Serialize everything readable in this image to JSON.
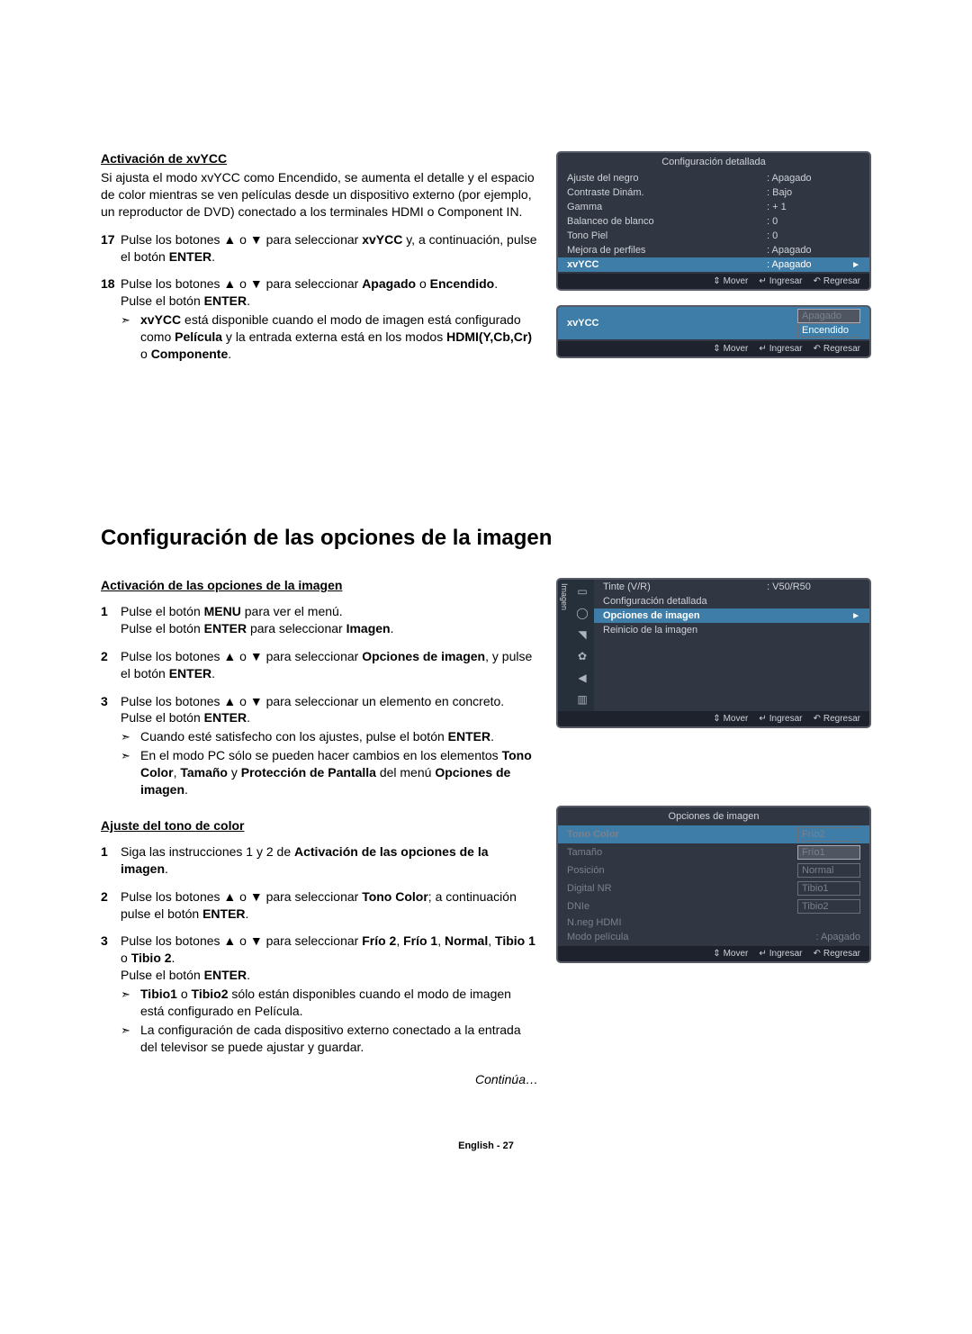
{
  "section1": {
    "title": "Activación de xvYCC",
    "intro": "Si ajusta el modo xvYCC como Encendido, se aumenta el detalle y el espacio de color mientras se ven películas desde un dispositivo externo (por ejemplo, un reproductor de DVD) conectado a los terminales HDMI o Component IN.",
    "step17_num": "17",
    "step17_a": "Pulse los botones ▲ o ▼ para seleccionar ",
    "step17_b": "xvYCC",
    "step17_c": " y, a continuación, pulse el botón ",
    "step17_d": "ENTER",
    "step17_e": ".",
    "step18_num": "18",
    "step18_a": "Pulse los botones ▲ o ▼ para seleccionar ",
    "step18_b": "Apagado",
    "step18_c": " o ",
    "step18_d": "Encendido",
    "step18_e": ".",
    "step18_f": "Pulse el botón ",
    "step18_g": "ENTER",
    "step18_h": ".",
    "note18_a": "xvYCC",
    "note18_b": " está disponible cuando el modo de imagen está configurado como ",
    "note18_c": "Película",
    "note18_d": " y la entrada externa está en los modos ",
    "note18_e": "HDMI(Y,Cb,Cr)",
    "note18_f": " o ",
    "note18_g": "Componente",
    "note18_h": "."
  },
  "heading2": "Configuración de las opciones de la imagen",
  "section2": {
    "title": "Activación de las opciones de la imagen",
    "s1_num": "1",
    "s1_a": "Pulse el botón ",
    "s1_b": "MENU",
    "s1_c": " para ver el menú.",
    "s1_d": "Pulse el botón ",
    "s1_e": "ENTER",
    "s1_f": " para seleccionar ",
    "s1_g": "Imagen",
    "s1_h": ".",
    "s2_num": "2",
    "s2_a": "Pulse los botones ▲ o ▼ para seleccionar ",
    "s2_b": "Opciones de imagen",
    "s2_c": ", y pulse el botón ",
    "s2_d": "ENTER",
    "s2_e": ".",
    "s3_num": "3",
    "s3_a": "Pulse los botones ▲ o ▼ para seleccionar un elemento en concreto.",
    "s3_b": "Pulse el botón ",
    "s3_c": "ENTER",
    "s3_d": ".",
    "n3a_a": "Cuando esté satisfecho con los ajustes, pulse el botón ",
    "n3a_b": "ENTER",
    "n3a_c": ".",
    "n3b_a": "En el modo PC sólo se pueden hacer cambios en los elementos ",
    "n3b_b": "Tono Color",
    "n3b_c": ", ",
    "n3b_d": "Tamaño",
    "n3b_e": " y ",
    "n3b_f": "Protección de Pantalla",
    "n3b_g": " del menú ",
    "n3b_h": "Opciones de imagen",
    "n3b_i": "."
  },
  "section3": {
    "title": "Ajuste del tono de color",
    "s1_num": "1",
    "s1_a": "Siga las instrucciones 1 y 2 de ",
    "s1_b": "Activación de las opciones de la imagen",
    "s1_c": ".",
    "s2_num": "2",
    "s2_a": "Pulse los botones ▲ o ▼ para seleccionar ",
    "s2_b": "Tono Color",
    "s2_c": "; a continuación pulse el botón ",
    "s2_d": "ENTER",
    "s2_e": ".",
    "s3_num": "3",
    "s3_a": "Pulse los botones ▲ o ▼ para seleccionar ",
    "s3_b": "Frío 2",
    "s3_c": ", ",
    "s3_d": "Frío 1",
    "s3_e": ", ",
    "s3_f": "Normal",
    "s3_g": ", ",
    "s3_h": "Tibio 1",
    "s3_i": " o ",
    "s3_j": "Tibio 2",
    "s3_k": ".",
    "s3_l": "Pulse el botón ",
    "s3_m": "ENTER",
    "s3_n": ".",
    "n3a_a": "Tibio1",
    "n3a_b": " o ",
    "n3a_c": "Tibio2",
    "n3a_d": " sólo están disponibles cuando el modo de imagen está configurado en Película.",
    "n3b": "La configuración de cada dispositivo externo conectado a la entrada del televisor se puede ajustar y guardar."
  },
  "continue": "Continúa…",
  "pagefoot": "English - 27",
  "osd1": {
    "title": "Configuración detallada",
    "rows": [
      {
        "label": "Ajuste del negro",
        "value": ": Apagado"
      },
      {
        "label": "Contraste Dinám.",
        "value": ": Bajo"
      },
      {
        "label": "Gamma",
        "value": ": + 1"
      },
      {
        "label": "Balanceo de blanco",
        "value": ": 0"
      },
      {
        "label": "Tono Piel",
        "value": ": 0"
      },
      {
        "label": "Mejora de perfiles",
        "value": ": Apagado"
      }
    ],
    "hl": {
      "label": "xvYCC",
      "value": ": Apagado",
      "arrow": "►"
    },
    "foot": {
      "move": "Mover",
      "enter": "Ingresar",
      "return": "Regresar"
    }
  },
  "osd2": {
    "label": "xvYCC",
    "opt1": "Apagado",
    "opt2": "Encendido",
    "foot": {
      "move": "Mover",
      "enter": "Ingresar",
      "return": "Regresar"
    }
  },
  "osd3": {
    "side": "Imagen",
    "row1": {
      "label": "Tinte (V/R)",
      "value": ": V50/R50"
    },
    "row2": {
      "label": "Configuración detallada"
    },
    "hl": {
      "label": "Opciones de imagen",
      "arrow": "►"
    },
    "row4": {
      "label": "Reinicio de la imagen"
    },
    "foot": {
      "move": "Mover",
      "enter": "Ingresar",
      "return": "Regresar"
    }
  },
  "osd4": {
    "title": "Opciones de imagen",
    "left": [
      "Tono Color",
      "Tamaño",
      "Posición",
      "Digital NR",
      "DNIe",
      "N.neg HDMI",
      "Modo película"
    ],
    "right_opts": [
      "Frío2",
      "Frío1",
      "Normal",
      "Tibio1",
      "Tibio2"
    ],
    "last": ": Apagado",
    "foot": {
      "move": "Mover",
      "enter": "Ingresar",
      "return": "Regresar"
    }
  }
}
